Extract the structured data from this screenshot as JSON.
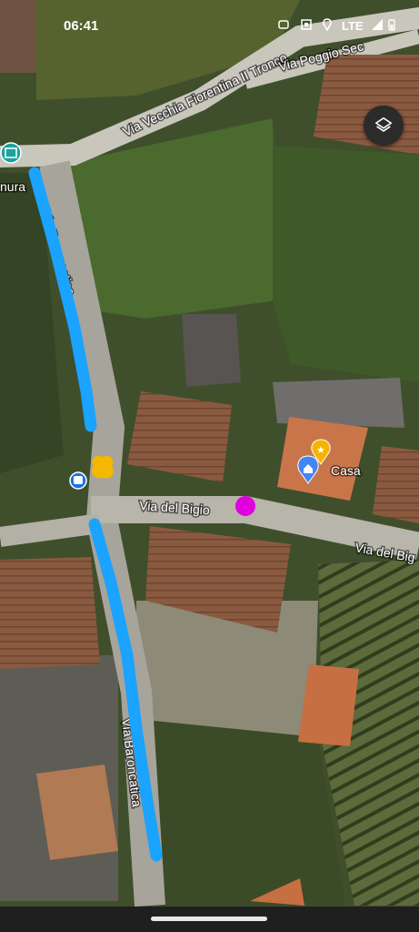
{
  "status_bar": {
    "time": "06:41",
    "network": "LTE"
  },
  "roads": {
    "via_vecchia_fiorentina": "Via Vecchia Fiorentina II Tronco",
    "via_poggio_secco": "Via Poggio Sec",
    "via_baroncatica_north": "Via Baroncatica",
    "via_baroncatica_south": "Via Baroncatica",
    "via_del_bigio_west": "Via del Bigio",
    "via_del_bigio_east": "Via del Big"
  },
  "places": {
    "partial_label": "nura",
    "home_label": "Casa"
  },
  "colors": {
    "route": "#1aa3ff",
    "marker_yellow": "#f5b800",
    "marker_magenta": "#e000e0",
    "home_pin": "#4285f4",
    "star_pin": "#f4b400"
  },
  "icons": {
    "layers": "layers-icon",
    "bus_stop": "bus-stop-icon",
    "home_pin": "home-pin-icon",
    "star_pin": "star-pin-icon",
    "museum": "museum-icon"
  }
}
